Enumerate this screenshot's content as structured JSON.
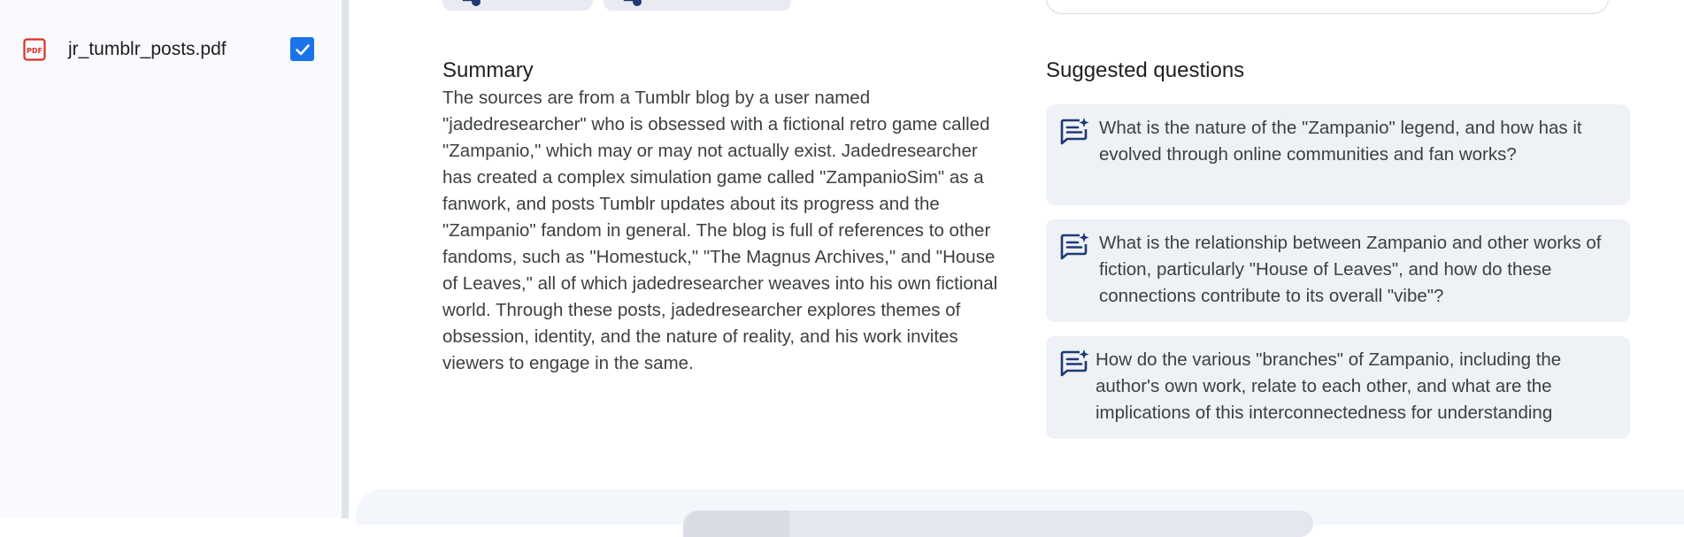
{
  "sources": {
    "items": [
      {
        "name": "jr_tumblr_posts.pdf",
        "icon": "pdf-icon",
        "checked": true
      }
    ]
  },
  "summary": {
    "heading": "Summary",
    "body": "The sources are from a Tumblr blog by a user named \"jadedresearcher\" who is obsessed with a fictional retro game called \"Zampanio,\" which may or may not actually exist. Jadedresearcher has created a complex simulation game called \"ZampanioSim\" as a fanwork, and posts Tumblr updates about its progress and the \"Zampanio\" fandom in general. The blog is full of references to other fandoms, such as \"Homestuck,\" \"The Magnus Archives,\" and \"House of Leaves,\" all of which jadedresearcher weaves into his own fictional world. Through these posts, jadedresearcher explores themes of obsession, identity, and the nature of reality, and his work invites viewers to engage in the same."
  },
  "suggested": {
    "heading": "Suggested questions",
    "questions": [
      "What is the nature of the \"Zampanio\" legend, and how has it evolved through online communities and fan works?",
      "What is the relationship between Zampanio and other works of fiction, particularly \"House of Leaves\", and how do these connections contribute to its overall \"vibe\"?",
      "How do the various \"branches\" of Zampanio, including the author's own work, relate to each other, and what are the implications of this interconnectedness for understanding"
    ]
  },
  "colors": {
    "accent": "#1a73e8",
    "pdf_red": "#d93025",
    "icon_navy": "#1f3b73"
  }
}
